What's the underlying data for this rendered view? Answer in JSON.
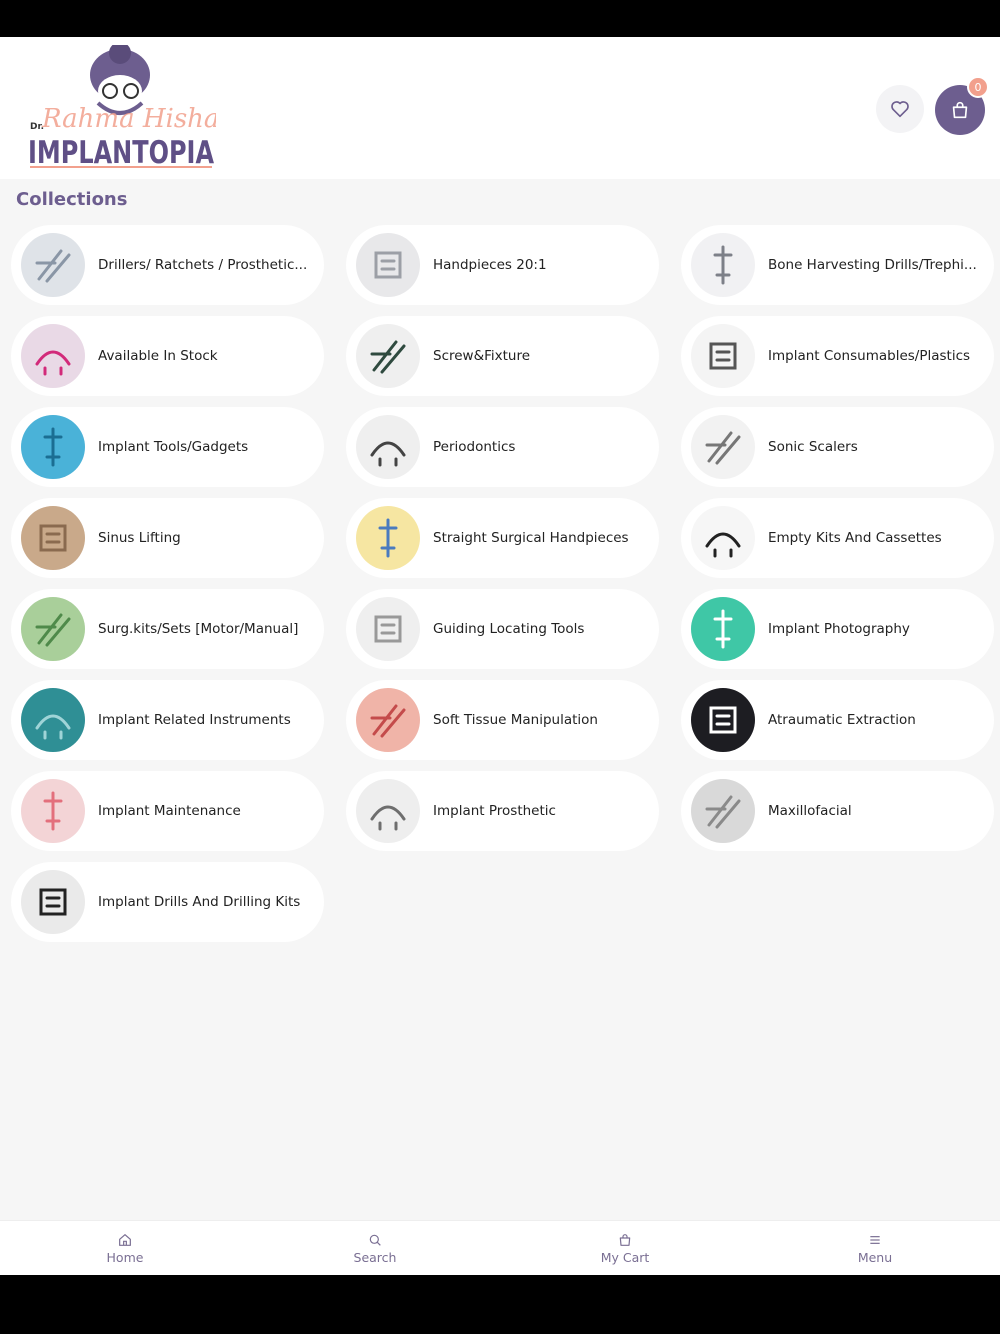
{
  "header": {
    "logo_prefix": "Dr.",
    "logo_script": "Rahma Hisham's",
    "logo_text": "IMPLANTOPIA",
    "cart_count": "0",
    "colors": {
      "accent": "#6d5e8f",
      "badge": "#f2a08d"
    }
  },
  "collections": {
    "title": "Collections",
    "items": [
      {
        "label": "Drillers/ Ratchets / Prosthetic...",
        "icon": "kit-tray-icon",
        "thumb": "#dfe3e8",
        "mark": "#8a96a6"
      },
      {
        "label": "Handpieces 20:1",
        "icon": "handpiece-icon",
        "thumb": "#e8e8ea",
        "mark": "#9c9fa6"
      },
      {
        "label": "Bone Harvesting Drills/Trephi...",
        "icon": "drill-icon",
        "thumb": "#f1f1f3",
        "mark": "#7d8088"
      },
      {
        "label": "Available In Stock",
        "icon": "in-stock-icon",
        "thumb": "#e9d9e6",
        "mark": "#d22a7a"
      },
      {
        "label": "Screw&Fixture",
        "icon": "screwdriver-icon",
        "thumb": "#efefef",
        "mark": "#2f4a3f"
      },
      {
        "label": "Implant Consumables/Plastics",
        "icon": "consumables-icon",
        "thumb": "#f4f4f4",
        "mark": "#555555"
      },
      {
        "label": "Implant Tools/Gadgets",
        "icon": "tools-icon",
        "thumb": "#4ab2d8",
        "mark": "#1b6e93"
      },
      {
        "label": "Periodontics",
        "icon": "perio-instrument-icon",
        "thumb": "#efefef",
        "mark": "#444444"
      },
      {
        "label": "Sonic Scalers",
        "icon": "scaler-icon",
        "thumb": "#f2f2f2",
        "mark": "#777777"
      },
      {
        "label": "Sinus Lifting",
        "icon": "sinus-icon",
        "thumb": "#c9a98a",
        "mark": "#8a6a4f"
      },
      {
        "label": "Straight Surgical Handpieces",
        "icon": "surgical-handpiece-icon",
        "thumb": "#f6e6a2",
        "mark": "#4a7bbf"
      },
      {
        "label": "Empty Kits And Cassettes",
        "icon": "cassette-icon",
        "thumb": "#f6f6f6",
        "mark": "#222222"
      },
      {
        "label": "Surg.kits/Sets [Motor/Manual]",
        "icon": "surgical-kit-icon",
        "thumb": "#a9cf9a",
        "mark": "#4f8a4a"
      },
      {
        "label": "Guiding Locating Tools",
        "icon": "guide-tool-icon",
        "thumb": "#efefef",
        "mark": "#999999"
      },
      {
        "label": "Implant Photography",
        "icon": "tooth-camera-icon",
        "thumb": "#3fc7a6",
        "mark": "#ffffff"
      },
      {
        "label": "Implant Related Instruments",
        "icon": "instruments-icon",
        "thumb": "#2f8f95",
        "mark": "#9fd4d7"
      },
      {
        "label": "Soft Tissue Manipulation",
        "icon": "soft-tissue-icon",
        "thumb": "#f0b4a8",
        "mark": "#c44b4b"
      },
      {
        "label": "Atraumatic Extraction",
        "icon": "extraction-icon",
        "thumb": "#1d1d22",
        "mark": "#ffffff"
      },
      {
        "label": "Implant Maintenance",
        "icon": "maintenance-icon",
        "thumb": "#f3d4d6",
        "mark": "#e36f7c"
      },
      {
        "label": "Implant Prosthetic",
        "icon": "prosthetic-icon",
        "thumb": "#eeeeee",
        "mark": "#6e6e6e"
      },
      {
        "label": "Maxillofacial",
        "icon": "maxillofacial-icon",
        "thumb": "#d9d9d9",
        "mark": "#8a8a8a"
      },
      {
        "label": "Implant Drills And Drilling Kits",
        "icon": "drill-set-icon",
        "thumb": "#eaeaea",
        "mark": "#222222"
      }
    ]
  },
  "tabbar": {
    "home": "Home",
    "search": "Search",
    "cart": "My Cart",
    "menu": "Menu"
  }
}
